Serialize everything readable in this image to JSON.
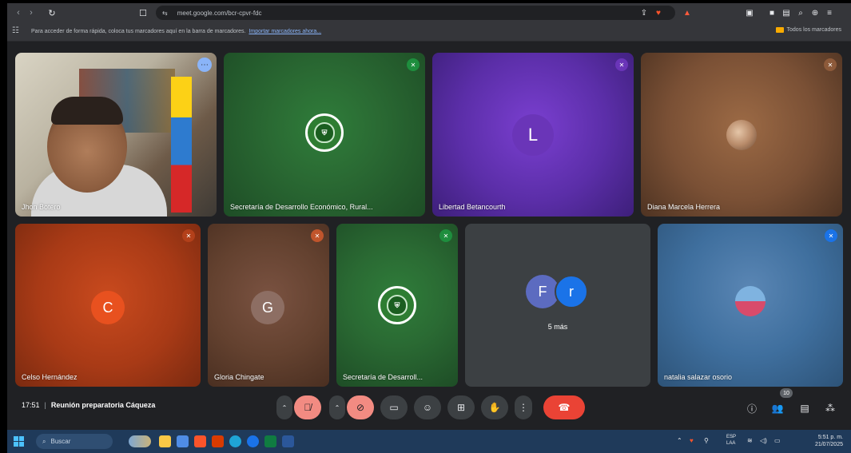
{
  "browser": {
    "url": "meet.google.com/bcr-cpvr-fdc",
    "bookmarks_hint": "Para acceder de forma rápida, coloca tus marcadores aquí en la barra de marcadores.",
    "bookmarks_link": "Importar marcadores ahora...",
    "all_bookmarks": "Todos los marcadores"
  },
  "participants": [
    {
      "name": "Jhon Botero",
      "type": "video"
    },
    {
      "name": "Secretaría de Desarrollo Económico, Rural...",
      "type": "logo"
    },
    {
      "name": "Libertad Betancourth",
      "type": "letter",
      "letter": "L",
      "color": "#6a35b8"
    },
    {
      "name": "Diana Marcela Herrera",
      "type": "photo"
    },
    {
      "name": "Celso Hernández",
      "type": "letter",
      "letter": "C",
      "color": "#e8511f"
    },
    {
      "name": "Gloria Chingate",
      "type": "letter",
      "letter": "G",
      "color": "#8d6e63"
    },
    {
      "name": "Secretaría de Desarroll...",
      "type": "logo"
    },
    {
      "name": "5 más",
      "type": "group",
      "letters": [
        "F",
        "r"
      ]
    },
    {
      "name": "natalia salazar osorio",
      "type": "photo"
    }
  ],
  "meeting": {
    "time": "17:51",
    "title": "Reunión preparatoria Cáqueza",
    "participant_count": "10"
  },
  "taskbar": {
    "search_label": "Buscar",
    "lang": "ESP",
    "lang_sub": "LAA",
    "clock": "5:51 p. m.",
    "date": "21/07/2025"
  },
  "colors": {
    "end_call": "#ea4335",
    "muted": "#f28b82",
    "control_bg": "#3c4043"
  }
}
